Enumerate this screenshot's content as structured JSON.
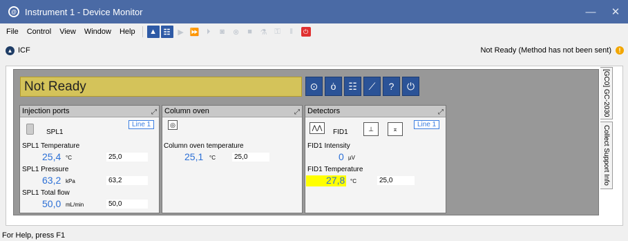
{
  "window": {
    "title": "Instrument 1 - Device Monitor",
    "minimize_glyph": "—",
    "close_glyph": "✕"
  },
  "menubar": {
    "items": [
      "File",
      "Control",
      "View",
      "Window",
      "Help"
    ]
  },
  "toolbar": {
    "icons": [
      "network-icon",
      "checklist-icon",
      "play-icon",
      "fast-forward-icon",
      "step-icon",
      "camera-icon",
      "cancel-icon",
      "stop-square-icon",
      "flask-icon",
      "key-icon",
      "pause-icon",
      "power-icon"
    ]
  },
  "icf": {
    "label": "ICF",
    "status": "Not Ready (Method has not been sent)",
    "warn_glyph": "!"
  },
  "device": {
    "status_text": "Not Ready",
    "side_tab_1": "[GC0] GC-2030",
    "side_tab_2": "Collect Support Info",
    "buttons": [
      "target-icon",
      "sample-icon",
      "checklist-icon",
      "flowline-icon",
      "help-icon",
      "power-icon"
    ],
    "button_glyphs": [
      "⊙",
      "ȯ",
      "☷",
      "⟋",
      "?",
      "⏻"
    ]
  },
  "injection_ports": {
    "title": "Injection ports",
    "line_tag": "Line 1",
    "device_name": "SPL1",
    "rows": [
      {
        "label": "SPL1 Temperature",
        "value": "25,4",
        "unit": "°C",
        "setpoint": "25,0"
      },
      {
        "label": "SPL1 Pressure",
        "value": "63,2",
        "unit": "kPa",
        "setpoint": "63,2"
      },
      {
        "label": "SPL1 Total flow",
        "value": "50,0",
        "unit": "mL/min",
        "setpoint": "50,0"
      }
    ]
  },
  "column_oven": {
    "title": "Column oven",
    "rows": [
      {
        "label": "Column oven temperature",
        "value": "25,1",
        "unit": "°C",
        "setpoint": "25,0"
      }
    ]
  },
  "detectors": {
    "title": "Detectors",
    "line_tag": "Line 1",
    "device_name": "FID1",
    "rows": [
      {
        "label": "FID1 Intensity",
        "value": "0",
        "unit": "µV"
      },
      {
        "label": "FID1 Temperature",
        "value": "27,8",
        "unit": "°C",
        "setpoint": "25,0"
      }
    ],
    "highlight_color": "#ffff00"
  },
  "help": {
    "text": "For Help, press F1"
  },
  "colors": {
    "titlebar": "#4a6aa5",
    "value_blue": "#2b6fd6",
    "status_yellow": "#d4c35a",
    "button_blue": "#2b5397"
  }
}
